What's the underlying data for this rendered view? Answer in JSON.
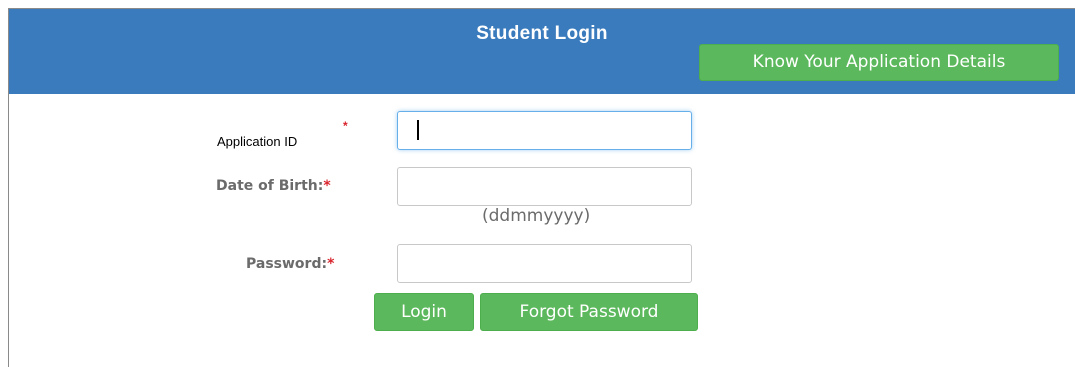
{
  "header": {
    "title": "Student Login",
    "details_button": "Know Your Application Details"
  },
  "form": {
    "application_id": {
      "label": "Application ID",
      "required_mark": "*",
      "value": ""
    },
    "date_of_birth": {
      "label": "Date of Birth:",
      "required_mark": "*",
      "value": "",
      "hint": "(ddmmyyyy)"
    },
    "password": {
      "label": "Password:",
      "required_mark": "*",
      "value": ""
    }
  },
  "actions": {
    "login": "Login",
    "forgot_password": "Forgot Password"
  },
  "colors": {
    "header_bg": "#3a7bbd",
    "button_green": "#5cb85c",
    "required_red": "#d9232d",
    "focus_blue": "#66afe9"
  }
}
